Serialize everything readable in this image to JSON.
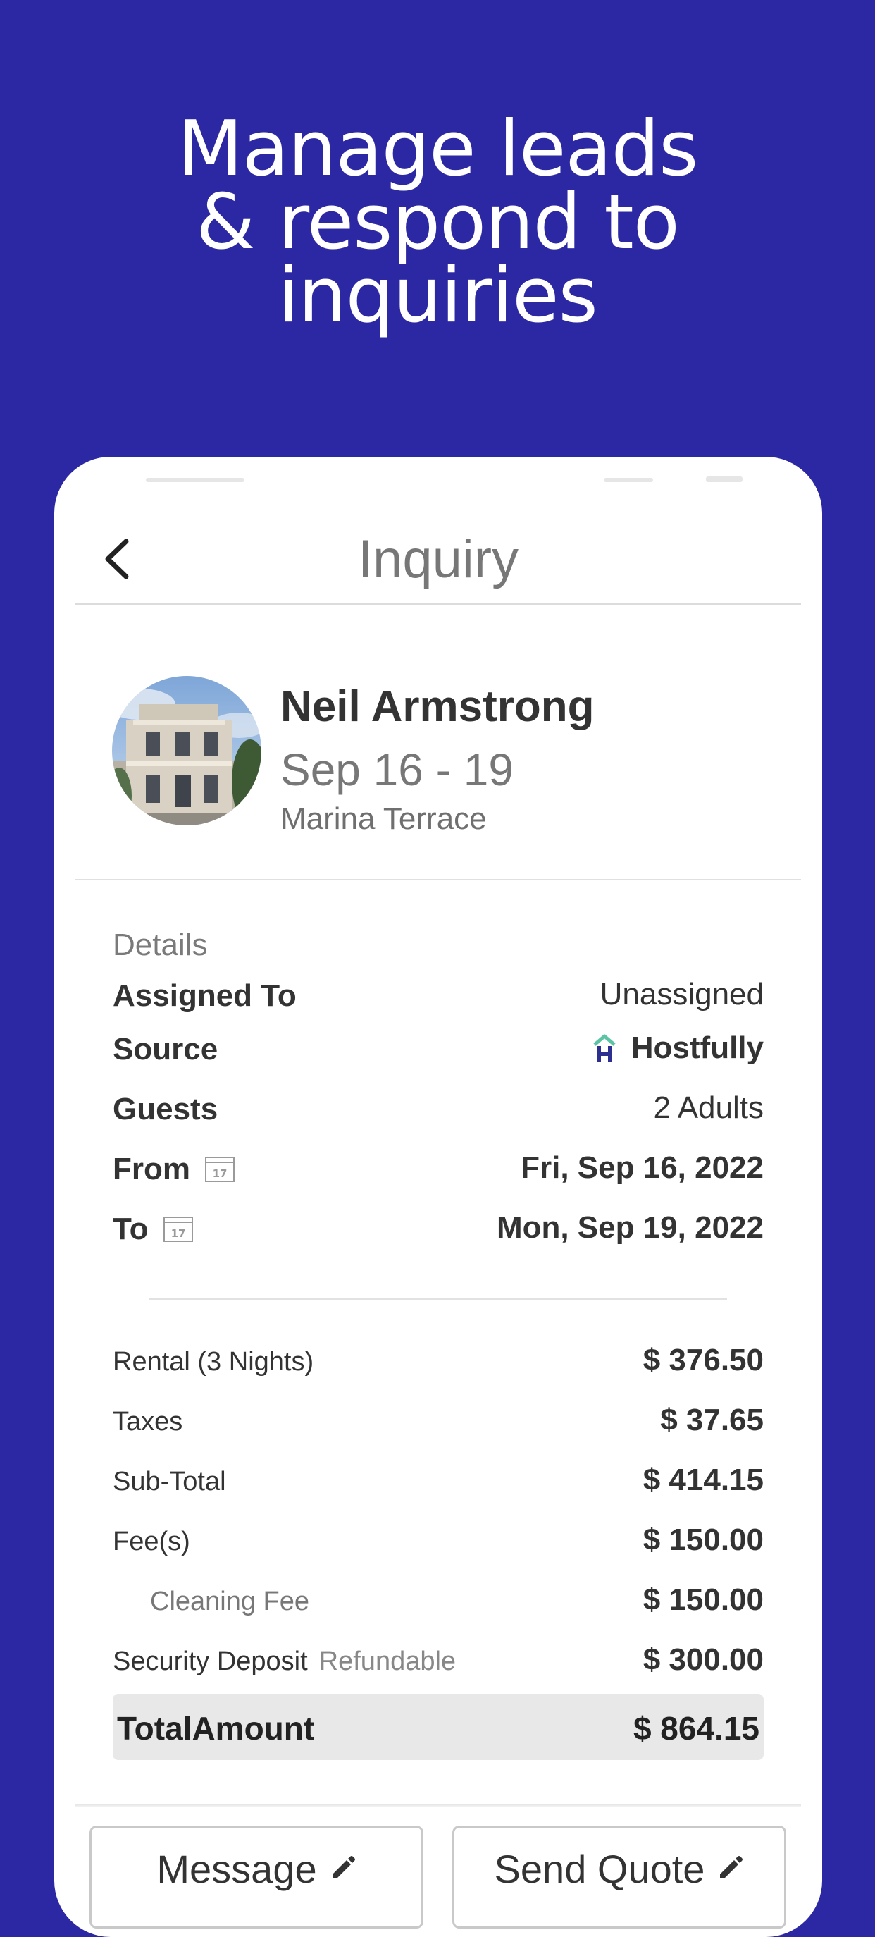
{
  "headline": {
    "line1": "Manage leads",
    "line2": "& respond to",
    "line3": "inquiries"
  },
  "header": {
    "title": "Inquiry",
    "back_icon": "chevron-left-icon"
  },
  "guest": {
    "name": "Neil Armstrong",
    "dates": "Sep 16 - 19",
    "property": "Marina Terrace"
  },
  "details": {
    "section_label": "Details",
    "assigned_to": {
      "label": "Assigned To",
      "value": "Unassigned"
    },
    "source": {
      "label": "Source",
      "value": "Hostfully",
      "icon": "hostfully-logo-icon"
    },
    "guests": {
      "label": "Guests",
      "value": "2 Adults"
    },
    "from": {
      "label": "From",
      "value": "Fri, Sep 16, 2022",
      "icon": "calendar-icon"
    },
    "to": {
      "label": "To",
      "value": "Mon, Sep 19, 2022",
      "icon": "calendar-icon"
    }
  },
  "pricing": {
    "rental": {
      "label": "Rental (3 Nights)",
      "value": "$ 376.50"
    },
    "taxes": {
      "label": "Taxes",
      "value": "$ 37.65"
    },
    "subtotal": {
      "label": "Sub-Total",
      "value": "$ 414.15"
    },
    "fees": {
      "label": "Fee(s)",
      "value": "$ 150.00"
    },
    "cleaning_fee": {
      "label": "Cleaning Fee",
      "value": "$ 150.00"
    },
    "security_deposit": {
      "label": "Security Deposit",
      "note": "Refundable",
      "value": "$ 300.00"
    },
    "total": {
      "label": "TotalAmount",
      "value": "$ 864.15"
    }
  },
  "actions": {
    "message": {
      "label": "Message",
      "icon": "pencil-icon"
    },
    "send_quote": {
      "label": "Send Quote",
      "icon": "pencil-icon"
    }
  },
  "colors": {
    "background": "#2c28a3",
    "card": "#ffffff",
    "text_dark": "#333333",
    "text_muted": "#777777",
    "logo_green": "#5cc4a4",
    "logo_navy": "#2c2f8f"
  }
}
